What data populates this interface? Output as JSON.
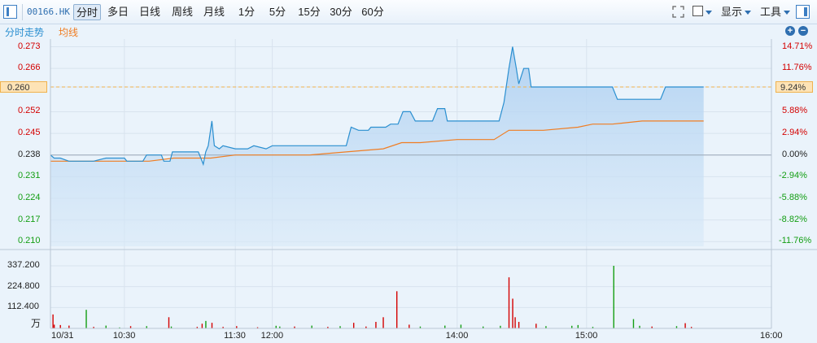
{
  "toolbar": {
    "code": "00166.HK",
    "tabs": [
      {
        "label": "分时",
        "active": true
      },
      {
        "label": "多日",
        "active": false
      },
      {
        "label": "日线",
        "active": false
      },
      {
        "label": "周线",
        "active": false
      },
      {
        "label": "月线",
        "active": false
      },
      {
        "label": "1分",
        "active": false
      },
      {
        "label": "5分",
        "active": false
      },
      {
        "label": "15分",
        "active": false
      },
      {
        "label": "30分",
        "active": false
      },
      {
        "label": "60分",
        "active": false
      }
    ],
    "display_label": "显示",
    "tools_label": "工具",
    "zoom_in": "+",
    "zoom_out": "−"
  },
  "legend": {
    "price_label": "分时走势",
    "avg_label": "均线",
    "price_color": "#2a8fd0",
    "avg_color": "#f07d22"
  },
  "colors": {
    "up": "#d40000",
    "down": "#139e13",
    "neutral": "#222222"
  },
  "chart_data": {
    "type": "line",
    "date_label": "10/31",
    "current_price_tag": "0.260",
    "current_pct_tag": "9.24%",
    "price_ticks": [
      {
        "label": "0.273",
        "value": 0.273
      },
      {
        "label": "0.266",
        "value": 0.266
      },
      {
        "label": "0.260",
        "value": 0.26
      },
      {
        "label": "0.252",
        "value": 0.252
      },
      {
        "label": "0.245",
        "value": 0.245
      },
      {
        "label": "0.238",
        "value": 0.238
      },
      {
        "label": "0.231",
        "value": 0.231
      },
      {
        "label": "0.224",
        "value": 0.224
      },
      {
        "label": "0.217",
        "value": 0.217
      },
      {
        "label": "0.210",
        "value": 0.21
      }
    ],
    "pct_ticks": [
      {
        "label": "14.71%",
        "value": 0.273
      },
      {
        "label": "11.76%",
        "value": 0.266
      },
      {
        "label": "9.24%",
        "value": 0.26
      },
      {
        "label": "5.88%",
        "value": 0.252
      },
      {
        "label": "2.94%",
        "value": 0.245
      },
      {
        "label": "0.00%",
        "value": 0.238
      },
      {
        "label": "-2.94%",
        "value": 0.231
      },
      {
        "label": "-5.88%",
        "value": 0.224
      },
      {
        "label": "-8.82%",
        "value": 0.217
      },
      {
        "label": "-11.76%",
        "value": 0.21
      }
    ],
    "ylim": [
      0.2085,
      0.2755
    ],
    "prev_close": 0.238,
    "time_ticks": [
      "10:30",
      "11:30",
      "12:00",
      "14:00",
      "15:00",
      "16:00"
    ],
    "price_series": [
      [
        0,
        0.238
      ],
      [
        3,
        0.237
      ],
      [
        8,
        0.237
      ],
      [
        15,
        0.236
      ],
      [
        30,
        0.236
      ],
      [
        35,
        0.236
      ],
      [
        45,
        0.237
      ],
      [
        60,
        0.237
      ],
      [
        62,
        0.236
      ],
      [
        75,
        0.236
      ],
      [
        78,
        0.238
      ],
      [
        90,
        0.238
      ],
      [
        92,
        0.236
      ],
      [
        95,
        0.236
      ],
      [
        97,
        0.236
      ],
      [
        99,
        0.239
      ],
      [
        120,
        0.239
      ],
      [
        122,
        0.237
      ],
      [
        124,
        0.235
      ],
      [
        126,
        0.239
      ],
      [
        128,
        0.241
      ],
      [
        131,
        0.249
      ],
      [
        133,
        0.241
      ],
      [
        137,
        0.24
      ],
      [
        140,
        0.241
      ],
      [
        150,
        0.24
      ],
      [
        160,
        0.24
      ],
      [
        165,
        0.241
      ],
      [
        175,
        0.24
      ],
      [
        180,
        0.241
      ],
      [
        195,
        0.241
      ],
      [
        210,
        0.241
      ],
      [
        240,
        0.241
      ],
      [
        244,
        0.247
      ],
      [
        250,
        0.246
      ],
      [
        258,
        0.246
      ],
      [
        260,
        0.247
      ],
      [
        272,
        0.247
      ],
      [
        276,
        0.248
      ],
      [
        282,
        0.248
      ],
      [
        286,
        0.252
      ],
      [
        292,
        0.252
      ],
      [
        296,
        0.249
      ],
      [
        310,
        0.249
      ],
      [
        314,
        0.253
      ],
      [
        320,
        0.253
      ],
      [
        322,
        0.249
      ],
      [
        336,
        0.249
      ],
      [
        352,
        0.249
      ],
      [
        364,
        0.249
      ],
      [
        368,
        0.255
      ],
      [
        372,
        0.266
      ],
      [
        375,
        0.273
      ],
      [
        378,
        0.266
      ],
      [
        380,
        0.261
      ],
      [
        384,
        0.266
      ],
      [
        388,
        0.266
      ],
      [
        390,
        0.26
      ],
      [
        395,
        0.26
      ],
      [
        420,
        0.26
      ],
      [
        456,
        0.26
      ],
      [
        460,
        0.256
      ],
      [
        470,
        0.256
      ],
      [
        485,
        0.256
      ],
      [
        495,
        0.256
      ],
      [
        499,
        0.26
      ],
      [
        510,
        0.26
      ],
      [
        530,
        0.26
      ]
    ],
    "avg_series": [
      [
        0,
        0.236
      ],
      [
        70,
        0.236
      ],
      [
        80,
        0.236
      ],
      [
        100,
        0.237
      ],
      [
        130,
        0.237
      ],
      [
        150,
        0.238
      ],
      [
        180,
        0.238
      ],
      [
        210,
        0.238
      ],
      [
        240,
        0.239
      ],
      [
        270,
        0.24
      ],
      [
        285,
        0.242
      ],
      [
        300,
        0.242
      ],
      [
        330,
        0.243
      ],
      [
        360,
        0.243
      ],
      [
        372,
        0.246
      ],
      [
        400,
        0.246
      ],
      [
        428,
        0.247
      ],
      [
        440,
        0.248
      ],
      [
        456,
        0.248
      ],
      [
        480,
        0.249
      ],
      [
        530,
        0.249
      ]
    ],
    "volume_ticks": [
      {
        "label": "337.200",
        "value": 337.2
      },
      {
        "label": "224.800",
        "value": 224.8
      },
      {
        "label": "112.400",
        "value": 112.4
      }
    ],
    "volume_unit": "万",
    "volume_max": 337.2,
    "volumes": [
      [
        2,
        75,
        "up"
      ],
      [
        3,
        20,
        "up"
      ],
      [
        8,
        18,
        "up"
      ],
      [
        15,
        15,
        "up"
      ],
      [
        29,
        100,
        "down"
      ],
      [
        35,
        8,
        "up"
      ],
      [
        45,
        15,
        "down"
      ],
      [
        56,
        5,
        "down"
      ],
      [
        65,
        12,
        "up"
      ],
      [
        78,
        12,
        "down"
      ],
      [
        96,
        60,
        "up"
      ],
      [
        98,
        10,
        "down"
      ],
      [
        119,
        8,
        "up"
      ],
      [
        123,
        25,
        "up"
      ],
      [
        126,
        40,
        "down"
      ],
      [
        131,
        30,
        "up"
      ],
      [
        140,
        8,
        "up"
      ],
      [
        151,
        12,
        "up"
      ],
      [
        168,
        6,
        "up"
      ],
      [
        183,
        14,
        "down"
      ],
      [
        186,
        10,
        "down"
      ],
      [
        198,
        10,
        "up"
      ],
      [
        212,
        15,
        "down"
      ],
      [
        225,
        8,
        "up"
      ],
      [
        235,
        12,
        "down"
      ],
      [
        246,
        30,
        "up"
      ],
      [
        256,
        10,
        "up"
      ],
      [
        264,
        35,
        "up"
      ],
      [
        270,
        60,
        "up"
      ],
      [
        281,
        200,
        "up"
      ],
      [
        291,
        20,
        "up"
      ],
      [
        300,
        10,
        "down"
      ],
      [
        320,
        15,
        "down"
      ],
      [
        333,
        20,
        "down"
      ],
      [
        351,
        10,
        "down"
      ],
      [
        365,
        14,
        "down"
      ],
      [
        372,
        275,
        "up"
      ],
      [
        375,
        160,
        "up"
      ],
      [
        377,
        60,
        "up"
      ],
      [
        380,
        35,
        "up"
      ],
      [
        394,
        25,
        "up"
      ],
      [
        402,
        12,
        "down"
      ],
      [
        423,
        14,
        "down"
      ],
      [
        428,
        18,
        "down"
      ],
      [
        440,
        8,
        "down"
      ],
      [
        457,
        337.2,
        "down"
      ],
      [
        473,
        50,
        "down"
      ],
      [
        478,
        14,
        "down"
      ],
      [
        488,
        10,
        "up"
      ],
      [
        508,
        12,
        "down"
      ],
      [
        515,
        28,
        "up"
      ],
      [
        520,
        8,
        "up"
      ]
    ]
  }
}
